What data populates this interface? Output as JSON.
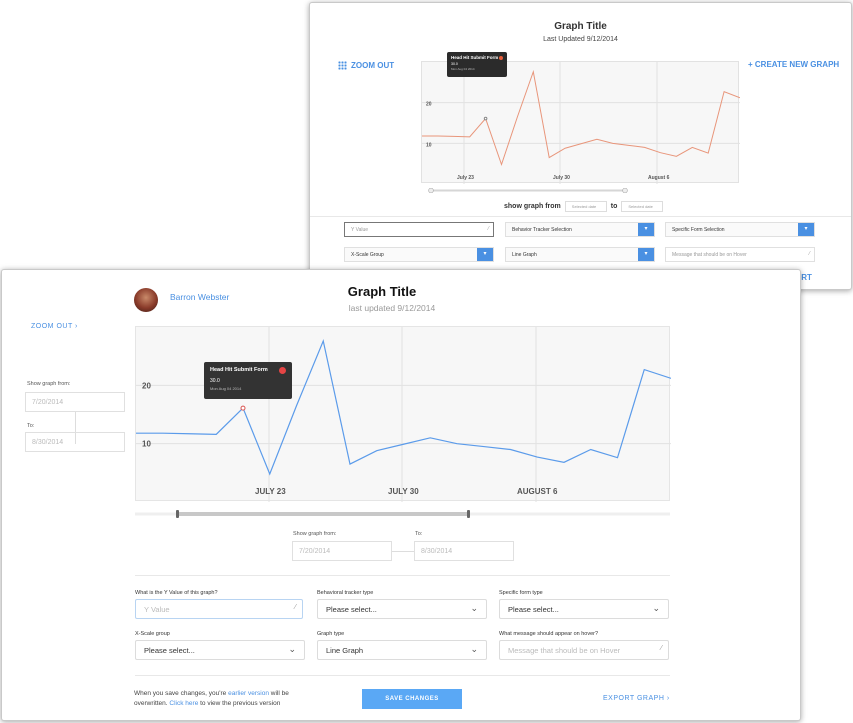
{
  "back": {
    "title": "Graph Title",
    "updated": "Last Updated 9/12/2014",
    "zoom_label": "ZOOM OUT",
    "create_label": "+ CREATE NEW GRAPH",
    "tooltip": {
      "title": "Head Hit Submit Form",
      "value": "30.0",
      "date": "Mon Aug 04 2014"
    },
    "y_ticks": [
      "20",
      "10"
    ],
    "x_ticks": [
      "July 23",
      "July 30",
      "August 6"
    ],
    "show_from": "show graph from",
    "to": "to",
    "from_placeholder": "Selected date",
    "to_placeholder": "Selected date",
    "fields": {
      "y_value": "Y Value",
      "behavior": "Behavior Tracker Selection",
      "specific": "Specific Form Selection",
      "xscale": "X-Scale Group",
      "graph_type": "Line Graph",
      "hover": "Message that should be on Hover"
    },
    "export_label": "ORT",
    "line_color": "#e8957a"
  },
  "front": {
    "username": "Barron Webster",
    "title": "Graph Title",
    "updated": "last updated 9/12/2014",
    "zoom_label": "ZOOM OUT ›",
    "side": {
      "show_from": "Show graph from:",
      "from_value": "7/20/2014",
      "to_label": "To:",
      "to_value": "8/30/2014"
    },
    "tooltip": {
      "title": "Head Hit Submit Form",
      "value": "30.0",
      "date": "Mon Aug 04 2014"
    },
    "y_ticks": [
      "20",
      "10"
    ],
    "x_ticks": [
      "JULY 23",
      "JULY 30",
      "AUGUST 6"
    ],
    "range": {
      "show_from": "Show graph from:",
      "from_value": "7/20/2014",
      "to_label": "To:",
      "to_value": "8/30/2014"
    },
    "fields": {
      "y_label": "What is the Y Value of this graph?",
      "y_placeholder": "Y Value",
      "behavior_label": "Behavioral tracker type",
      "behavior_value": "Please select...",
      "specific_label": "Specific form type",
      "specific_value": "Please select...",
      "xscale_label": "X-Scale group",
      "xscale_value": "Please select...",
      "graph_type_label": "Graph type",
      "graph_type_value": "Line Graph",
      "hover_label": "What message should appear on hover?",
      "hover_placeholder": "Message that should be on Hover"
    },
    "note_a": "When you save changes, you're ",
    "note_link1": "earlier version",
    "note_b": " will be overwritten. ",
    "note_link2": "Click here",
    "note_c": " to view the previous version",
    "save_label": "SAVE CHANGES",
    "export_label": "EXPORT GRAPH ›",
    "line_color": "#5b9bea"
  },
  "chart_data": {
    "type": "line",
    "x": [
      "Jul 17",
      "Jul 18",
      "Jul 19",
      "Jul 20",
      "Jul 21",
      "Jul 22",
      "Jul 23",
      "Jul 24",
      "Jul 25",
      "Jul 26",
      "Jul 27",
      "Jul 28",
      "Jul 29",
      "Jul 30",
      "Jul 31",
      "Aug 1",
      "Aug 2",
      "Aug 3",
      "Aug 4",
      "Aug 5",
      "Aug 6"
    ],
    "series": [
      {
        "values": [
          11.8,
          11.8,
          11.7,
          11.6,
          16.1,
          4.8,
          16.5,
          27.6,
          6.5,
          8.8,
          9.9,
          11.0,
          10.0,
          9.5,
          9.0,
          7.7,
          6.8,
          9.0,
          7.6,
          22.7,
          21.2
        ]
      }
    ],
    "y_ticks": [
      "20",
      "10"
    ],
    "x_ticks": [
      "JULY 23",
      "JULY 30",
      "AUGUST 6"
    ],
    "ylim": [
      0,
      30
    ],
    "grid": true
  }
}
